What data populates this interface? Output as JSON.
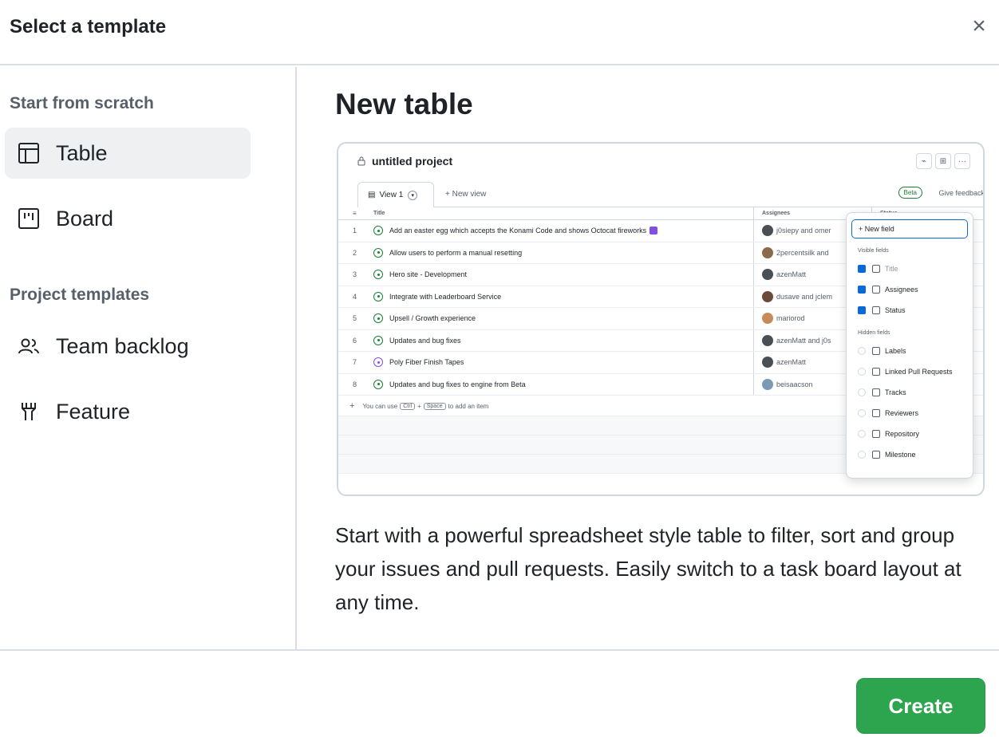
{
  "dialog": {
    "title": "Select a template",
    "close_icon": "close-icon"
  },
  "sidebar": {
    "section_scratch": "Start from scratch",
    "section_templates": "Project templates",
    "items": [
      {
        "label": "Table",
        "icon": "table-icon",
        "selected": true
      },
      {
        "label": "Board",
        "icon": "board-icon",
        "selected": false
      },
      {
        "label": "Team backlog",
        "icon": "people-icon",
        "selected": false
      },
      {
        "label": "Feature",
        "icon": "feature-icon",
        "selected": false
      }
    ]
  },
  "main": {
    "title": "New table",
    "description": "Start with a powerful spreadsheet style table to filter, sort and group your issues and pull requests. Easily switch to a task board layout at any time."
  },
  "preview": {
    "project_name": "untitled project",
    "tab_label": "View 1",
    "new_view": "+ New view",
    "beta": "Beta",
    "feedback": "Give feedback",
    "columns": {
      "title": "Title",
      "assignees": "Assignees",
      "status": "Status"
    },
    "rows": [
      {
        "num": "1",
        "title": "Add an easter egg which accepts the Konami Code and shows Octocat fireworks",
        "assignee": "j0siepy and omer"
      },
      {
        "num": "2",
        "title": "Allow users to perform a manual resetting",
        "assignee": "2percentsilk and"
      },
      {
        "num": "3",
        "title": "Hero site - Development",
        "assignee": "azenMatt"
      },
      {
        "num": "4",
        "title": "Integrate with Leaderboard Service",
        "assignee": "dusave and jclem"
      },
      {
        "num": "5",
        "title": "Upsell / Growth experience",
        "assignee": "mariorod"
      },
      {
        "num": "6",
        "title": "Updates and bug fixes",
        "assignee": "azenMatt and j0s"
      },
      {
        "num": "7",
        "title": "Poly Fiber Finish Tapes",
        "assignee": "azenMatt"
      },
      {
        "num": "8",
        "title": "Updates and bug fixes to engine from Beta",
        "assignee": "beisaacson"
      }
    ],
    "add_item": {
      "prefix": "You can use",
      "key1": "Ctrl",
      "plus": "+",
      "key2": "Space",
      "suffix": "to add an item"
    },
    "menu": {
      "new_field": "+ New field",
      "visible_heading": "Visible fields",
      "visible": [
        "Title",
        "Assignees",
        "Status"
      ],
      "hidden_heading": "Hidden fields",
      "hidden": [
        "Labels",
        "Linked Pull Requests",
        "Tracks",
        "Reviewers",
        "Repository",
        "Milestone"
      ]
    }
  },
  "footer": {
    "create_label": "Create"
  },
  "colors": {
    "accent": "#2da44e",
    "selected_bg": "#eef0f2",
    "border": "#d8dee4",
    "link_blue": "#0969da"
  }
}
